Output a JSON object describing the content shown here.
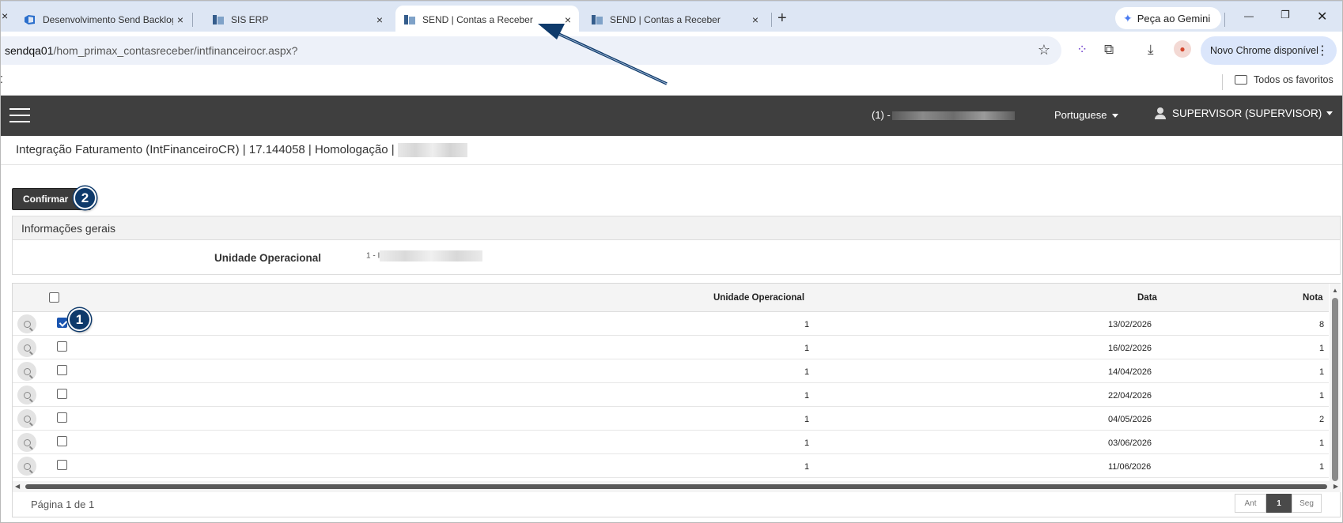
{
  "browser": {
    "tabs": [
      {
        "title": "Desenvolvimento Send Backlog",
        "active": false
      },
      {
        "title": "SIS ERP",
        "active": false
      },
      {
        "title": "SEND | Contas a Receber",
        "active": true
      },
      {
        "title": "SEND | Contas a Receber",
        "active": false
      }
    ],
    "partial_close": "×",
    "close_glyph": "×",
    "new_tab": "+",
    "gemini_label": "Peça ao Gemini",
    "url_host": "sendqa01",
    "url_path": "/hom_primax_contasreceber/intfinanceirocr.aspx?",
    "update_label": "Novo Chrome disponível",
    "bookmarks_all": "Todos os favoritos",
    "window_controls": {
      "minimize": "—",
      "restore": "❐",
      "close": "✕"
    }
  },
  "app": {
    "company_prefix": "(1) -",
    "language": "Portuguese",
    "user": "SUPERVISOR (SUPERVISOR)",
    "page_title": "Integração Faturamento (IntFinanceiroCR) | 17.144058 | Homologação |",
    "confirm_label": "Confirmar",
    "panel_title": "Informações gerais",
    "unidade_label": "Unidade Operacional",
    "unidade_value_prefix": "1 - I"
  },
  "grid": {
    "columns": [
      "Unidade Operacional",
      "Data",
      "Nota"
    ],
    "rows": [
      {
        "checked": true,
        "unidade": "1",
        "data": "13/02/2026",
        "nota": "8"
      },
      {
        "checked": false,
        "unidade": "1",
        "data": "16/02/2026",
        "nota": "1"
      },
      {
        "checked": false,
        "unidade": "1",
        "data": "14/04/2026",
        "nota": "1"
      },
      {
        "checked": false,
        "unidade": "1",
        "data": "22/04/2026",
        "nota": "1"
      },
      {
        "checked": false,
        "unidade": "1",
        "data": "04/05/2026",
        "nota": "2"
      },
      {
        "checked": false,
        "unidade": "1",
        "data": "03/06/2026",
        "nota": "1"
      },
      {
        "checked": false,
        "unidade": "1",
        "data": "11/06/2026",
        "nota": "1"
      }
    ],
    "pager_text": "Página 1 de 1",
    "pager_prev": "Ant",
    "pager_current": "1",
    "pager_next": "Seg"
  },
  "annotations": {
    "badge_1": "1",
    "badge_2": "2",
    "arrow_color": "#0e3a6b"
  },
  "colors": {
    "appbar": "#3f3f3f",
    "tabstrip": "#dde6f4",
    "checkbox_checked": "#1a55b0",
    "badge": "#0e3a6b"
  }
}
